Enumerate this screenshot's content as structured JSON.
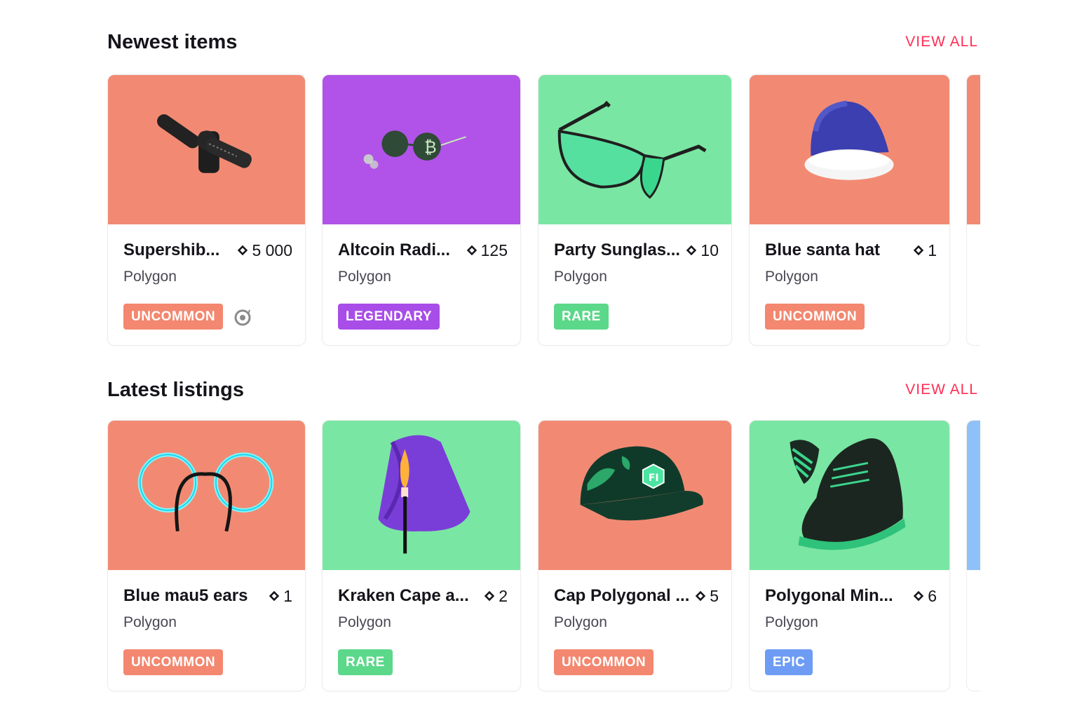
{
  "colors": {
    "uncommon": "#f3876f",
    "legendary": "#a84de8",
    "rare": "#5cd88a",
    "epic": "#6e9cf5",
    "accent": "#ff2d55",
    "bg_orange": "#f28a73",
    "bg_purple": "#b153e8",
    "bg_green": "#7ae6a3",
    "bg_blue": "#8ec1f7"
  },
  "newest": {
    "title": "Newest items",
    "view_all": "VIEW ALL",
    "items": [
      {
        "name": "Supershib...",
        "price": "5 000",
        "network": "Polygon",
        "rarity": "UNCOMMON",
        "icon": "microphone-icon",
        "extra_icon": "clock-coin-icon"
      },
      {
        "name": "Altcoin Radi...",
        "price": "125",
        "network": "Polygon",
        "rarity": "LEGENDARY",
        "icon": "coin-glasses-icon"
      },
      {
        "name": "Party Sunglas...",
        "price": "10",
        "network": "Polygon",
        "rarity": "RARE",
        "icon": "sunglasses-icon"
      },
      {
        "name": "Blue santa hat",
        "price": "1",
        "network": "Polygon",
        "rarity": "UNCOMMON",
        "icon": "santa-hat-icon"
      }
    ]
  },
  "latest": {
    "title": "Latest listings",
    "view_all": "VIEW ALL",
    "items": [
      {
        "name": "Blue mau5 ears",
        "price": "1",
        "network": "Polygon",
        "rarity": "UNCOMMON",
        "icon": "mouse-ears-icon"
      },
      {
        "name": "Kraken Cape a...",
        "price": "2",
        "network": "Polygon",
        "rarity": "RARE",
        "icon": "cape-icon"
      },
      {
        "name": "Cap Polygonal ...",
        "price": "5",
        "network": "Polygon",
        "rarity": "UNCOMMON",
        "icon": "cap-icon"
      },
      {
        "name": "Polygonal Min...",
        "price": "6",
        "network": "Polygon",
        "rarity": "EPIC",
        "icon": "sneaker-icon"
      }
    ]
  }
}
